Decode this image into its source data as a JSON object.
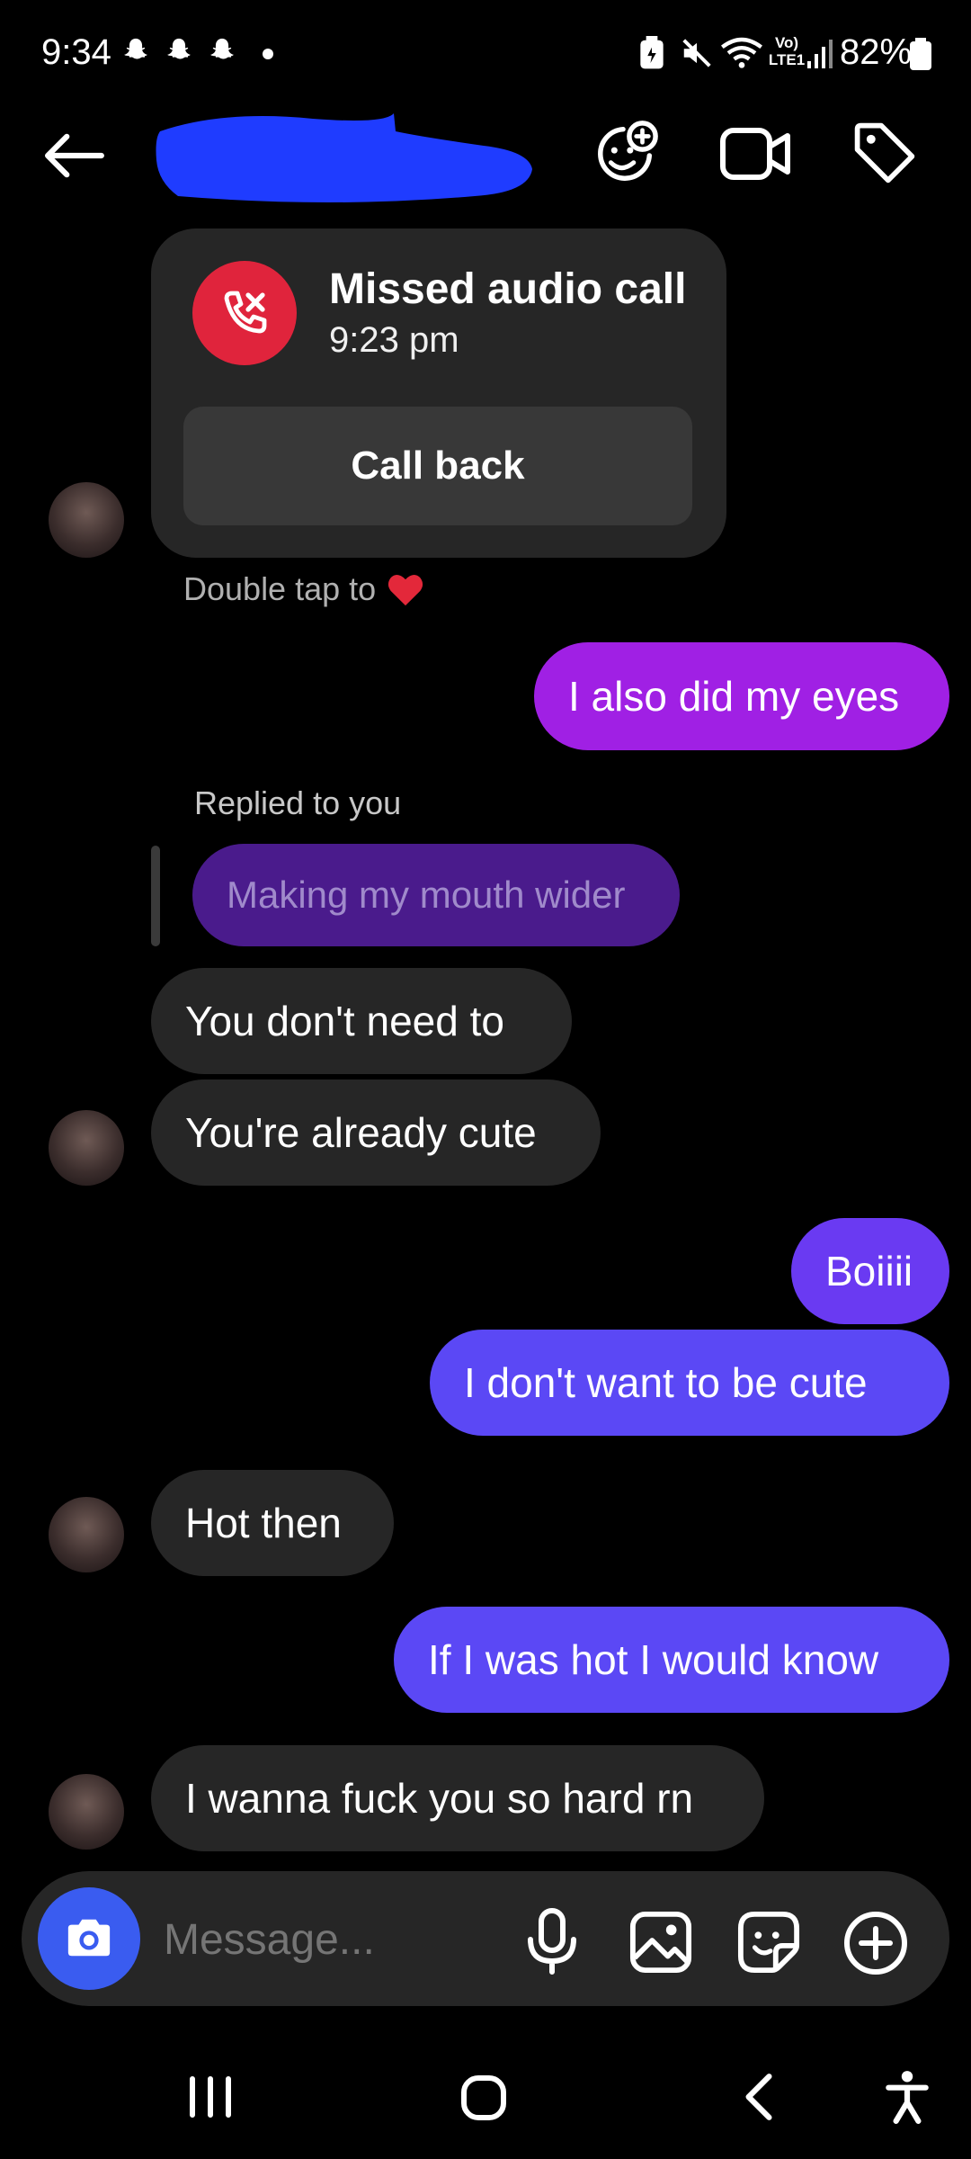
{
  "status_bar": {
    "time": "9:34",
    "battery": "82%",
    "notification_icons": [
      "snapchat-icon",
      "snapchat-icon",
      "snapchat-icon"
    ],
    "right_icons": [
      "battery-saver-icon",
      "mute-icon",
      "wifi-icon",
      "volte-icon",
      "signal-icon",
      "battery-icon"
    ]
  },
  "header": {
    "back_icon": "back-arrow-icon",
    "actions": [
      "effects-icon",
      "video-call-icon",
      "tag-icon"
    ]
  },
  "call_card": {
    "title": "Missed audio call",
    "time": "9:23 pm",
    "button": "Call back"
  },
  "double_tap_hint": "Double tap to",
  "messages": {
    "m1": "I also did my eyes",
    "reply_label": "Replied to you",
    "reply_quote": "Making my mouth wider",
    "m2": "You don't need to",
    "m3": "You're already cute",
    "m4": "Boiiii",
    "m5": "I don't want to be cute",
    "m6": "Hot then",
    "m7": "If I was hot I would know",
    "m8": "I wanna fuck you so hard rn"
  },
  "composer": {
    "placeholder": "Message..."
  },
  "colors": {
    "incoming": "#262626",
    "outgoing_purple": "#a020e4",
    "outgoing_indigo": "#6a3af2",
    "outgoing_blue": "#5b48f5",
    "missed_red": "#e0243c",
    "camera_blue": "#3a5cf0"
  }
}
